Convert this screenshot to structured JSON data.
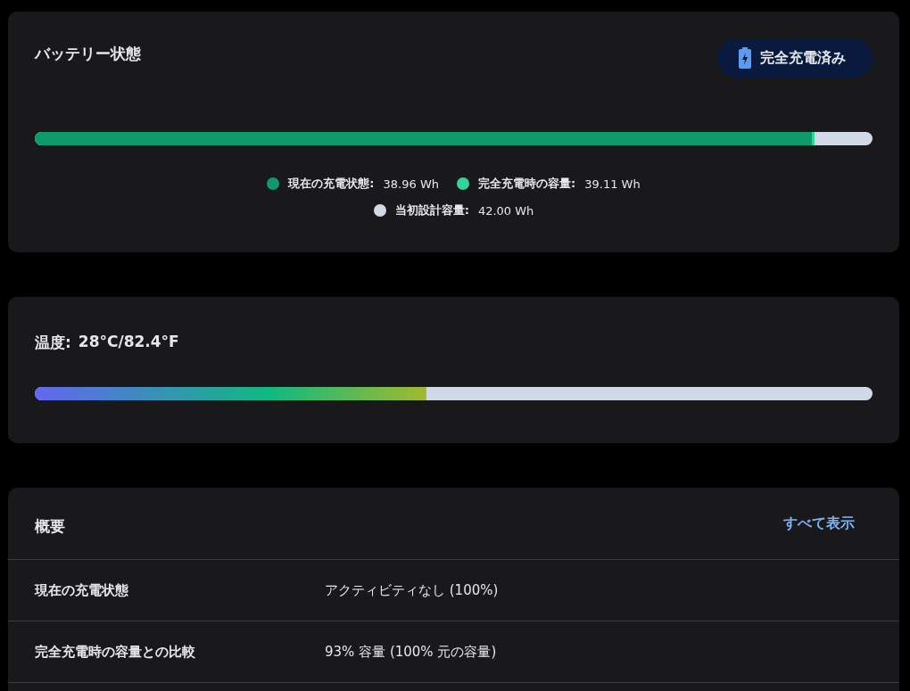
{
  "battery": {
    "title": "バッテリー状態",
    "badge": "完全充電済み",
    "bar": [
      {
        "level": 0.931
      },
      {
        "level": 0.928
      }
    ],
    "legend": [
      {
        "label": "現在の充電状態:",
        "value": "38.96 Wh",
        "color": "#0f9a6c"
      },
      {
        "label": "完全充電時の容量:",
        "value": "39.11 Wh",
        "color": "#34d399"
      },
      {
        "label": "当初設計容量:",
        "value": "42.00 Wh",
        "color": "#d1d9e6"
      }
    ]
  },
  "temperature": {
    "label": "温度:",
    "value": "28°C/82.4°F",
    "level": 0.467
  },
  "summary": {
    "title": "概要",
    "link": "すべて表示",
    "rows": [
      {
        "label": "現在の充電状態",
        "value": "アクティビティなし (100%)"
      },
      {
        "label": "完全充電時の容量との比較",
        "value": "93% 容量 (100% 元の容量)"
      }
    ]
  }
}
